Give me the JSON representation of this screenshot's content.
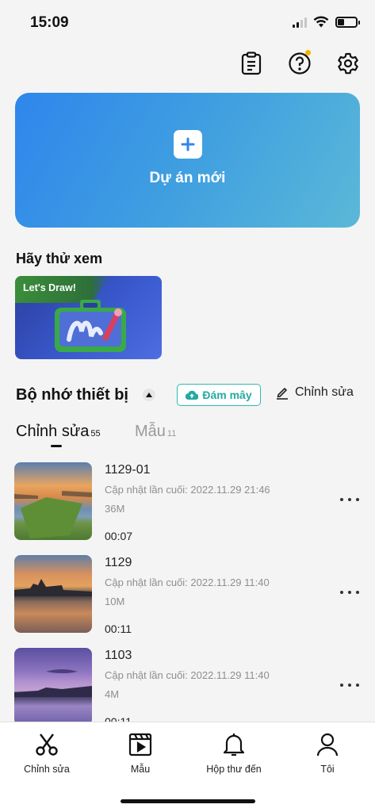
{
  "status_bar": {
    "time": "15:09",
    "battery_level": 0.35
  },
  "top_icons": [
    "clipboard-icon",
    "help-icon",
    "settings-icon"
  ],
  "new_project": {
    "label": "Dự án mới",
    "icon": "plus-icon"
  },
  "try_section": {
    "title": "Hãy thử xem",
    "card_tag": "Let's Draw!"
  },
  "device_storage": {
    "title": "Bộ nhớ thiết bị",
    "cloud_label": "Đám mây",
    "edit_label": "Chỉnh sửa"
  },
  "tabs": [
    {
      "label": "Chỉnh sửa",
      "count": "55",
      "active": true
    },
    {
      "label": "Mẫu",
      "count": "11",
      "active": false
    }
  ],
  "projects": [
    {
      "title": "1129-01",
      "updated": "Cập nhật lần cuối: 2022.11.29 21:46",
      "size": "36M",
      "duration": "00:07"
    },
    {
      "title": "1129",
      "updated": "Cập nhật lần cuối: 2022.11.29 11:40",
      "size": "10M",
      "duration": "00:11"
    },
    {
      "title": "1103",
      "updated": "Cập nhật lần cuối: 2022.11.29 11:40",
      "size": "4M",
      "duration": "00:11"
    }
  ],
  "bottom_nav": [
    {
      "label": "Chỉnh sửa",
      "icon": "scissors-icon"
    },
    {
      "label": "Mẫu",
      "icon": "template-icon"
    },
    {
      "label": "Hộp thư đến",
      "icon": "bell-icon"
    },
    {
      "label": "Tôi",
      "icon": "profile-icon"
    }
  ]
}
